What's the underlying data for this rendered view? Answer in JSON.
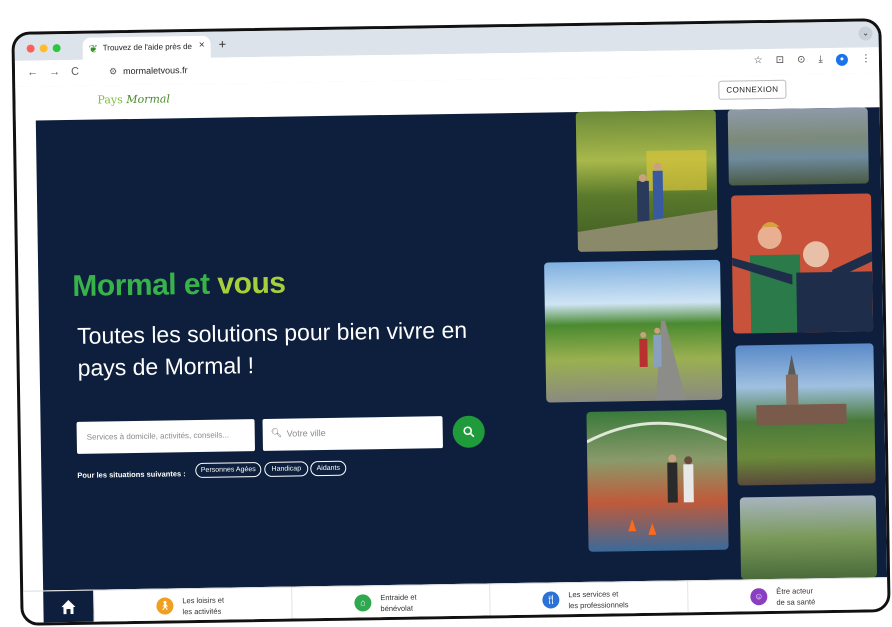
{
  "browser": {
    "tab_title": "Trouvez de l'aide près de chez",
    "tab_close": "×",
    "new_tab": "+",
    "url": "mormaletvous.fr",
    "nav_back": "←",
    "nav_forward": "→",
    "nav_reload": "C",
    "tab_menu": "⌄",
    "toolbar_icons": {
      "star": "☆",
      "extensions": "⊡",
      "cast": "⊙",
      "download": "⤓",
      "menu": "⋮"
    }
  },
  "site": {
    "logo_text": "Mormal",
    "logo_prefix": "Pays",
    "connexion_label": "CONNEXION"
  },
  "hero": {
    "brand_part1": "Mormal et ",
    "brand_part2": "vous",
    "tagline": "Toutes les solutions pour bien vivre en pays de Mormal !",
    "search_services_placeholder": "Services à domicile, activités, conseils...",
    "search_city_placeholder": "Votre ville",
    "situations_label": "Pour les situations suivantes :",
    "chips": [
      "Personnes Agées",
      "Handicap",
      "Aidants"
    ],
    "colors": {
      "bg": "#0d1f3c",
      "brand_green": "#37b34a",
      "brand_lime": "#a6d03a",
      "search_button": "#1f9b3b"
    }
  },
  "bottom_nav": {
    "home_icon": "home-icon",
    "items": [
      {
        "label_line1": "Les loisirs et",
        "label_line2": "les activités",
        "icon": "person-walking-icon",
        "color": "#f0a020"
      },
      {
        "label_line1": "Entraide et",
        "label_line2": "bénévolat",
        "icon": "home-heart-icon",
        "color": "#2fa84f"
      },
      {
        "label_line1": "Les services et",
        "label_line2": "les professionnels",
        "icon": "cutlery-icon",
        "color": "#2a72d6"
      },
      {
        "label_line1": "Être acteur",
        "label_line2": "de sa santé",
        "icon": "smile-icon",
        "color": "#8a3fc2"
      }
    ]
  }
}
